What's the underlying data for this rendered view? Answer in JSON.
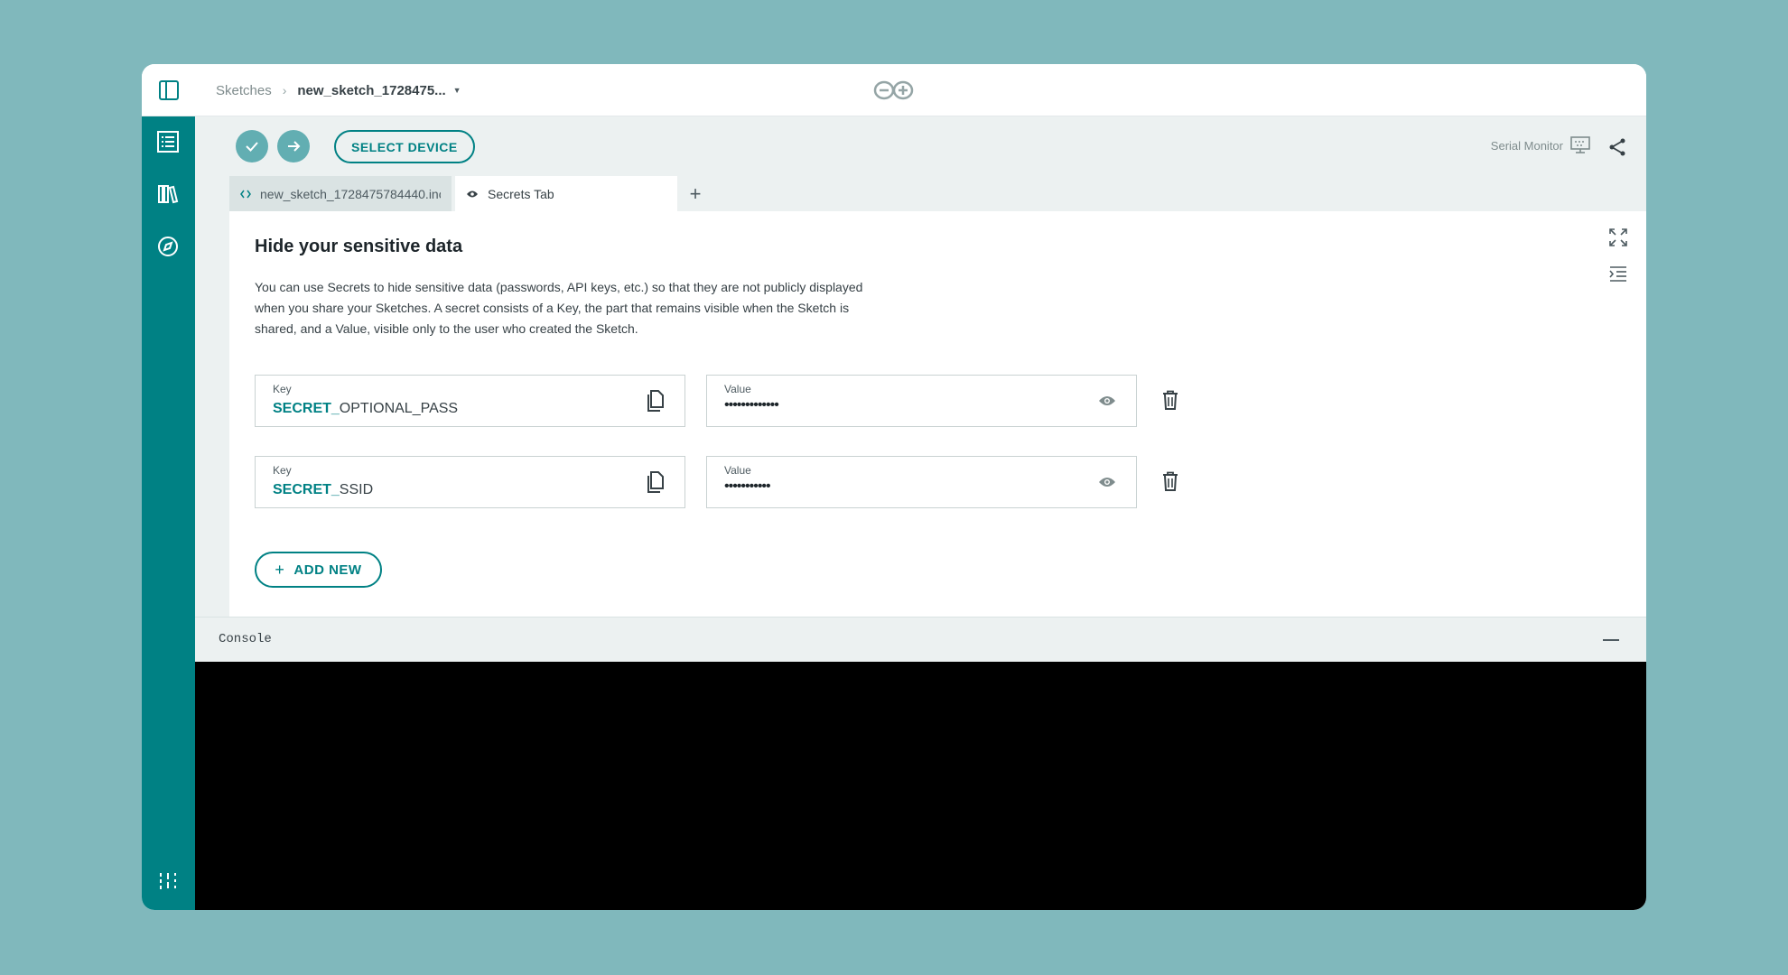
{
  "topbar": {
    "breadcrumb_root": "Sketches",
    "sketch_name": "new_sketch_1728475..."
  },
  "toolbar": {
    "select_device_label": "SELECT DEVICE",
    "serial_monitor_label": "Serial Monitor"
  },
  "tabs": {
    "code_tab_label": "new_sketch_1728475784440.ino",
    "secrets_tab_label": "Secrets Tab",
    "add_tab_label": "+"
  },
  "secrets": {
    "heading": "Hide your sensitive data",
    "description": "You can use Secrets to hide sensitive data (passwords, API keys, etc.) so that they are not publicly displayed when you share your Sketches. A secret consists of a Key, the part that remains visible when the Sketch is shared, and a Value, visible only to the user who created the Sketch.",
    "key_label": "Key",
    "value_label": "Value",
    "key_prefix": "SECRET_",
    "items": [
      {
        "key_suffix": "OPTIONAL_PASS",
        "value_masked": "•••••••••••••"
      },
      {
        "key_suffix": "SSID",
        "value_masked": "•••••••••••"
      }
    ],
    "add_new_label": "ADD NEW"
  },
  "console": {
    "label": "Console"
  },
  "colors": {
    "accent": "#008184",
    "accent_light": "#62aeb2",
    "background": "#80b8bc",
    "panel": "#ecf1f1"
  },
  "icons": {
    "sidebar_toggle": "sidebar-toggle-icon",
    "logo": "arduino-logo",
    "nav": [
      "sketchbook-icon",
      "libraries-icon",
      "reference-icon",
      "settings-sliders-icon"
    ],
    "verify": "check-icon",
    "upload": "arrow-right-icon",
    "serial_monitor": "monitor-icon",
    "share": "share-icon",
    "copy": "copy-icon",
    "reveal": "eye-icon",
    "delete": "trash-icon",
    "expand": "expand-icon",
    "indent": "indent-icon"
  }
}
